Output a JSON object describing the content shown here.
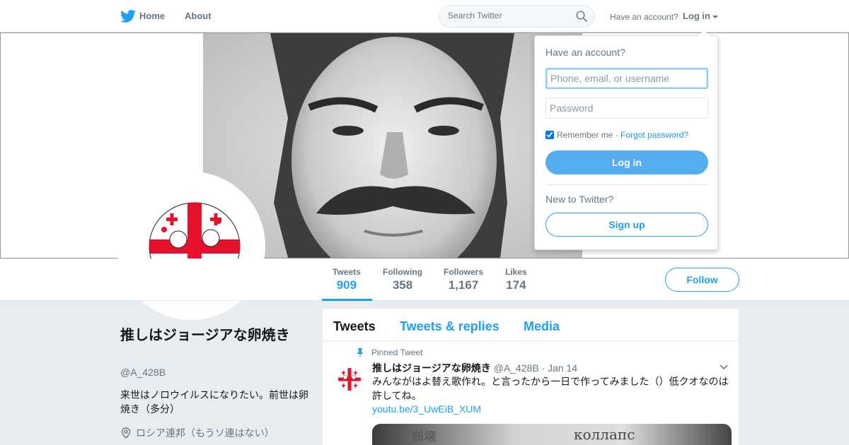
{
  "topbar": {
    "home_label": "Home",
    "about_label": "About",
    "search_placeholder": "Search Twitter",
    "have_account": "Have an account?",
    "login_label": "Log in"
  },
  "profile": {
    "name": "推しはジョージアな卵焼き",
    "handle": "@A_428B",
    "bio": "来世はノロウイルスになりたい。前世は卵焼き（多分）",
    "location": "ロシア連邦（もうソ連はない）"
  },
  "stats": [
    {
      "label": "Tweets",
      "value": "909"
    },
    {
      "label": "Following",
      "value": "358"
    },
    {
      "label": "Followers",
      "value": "1,167"
    },
    {
      "label": "Likes",
      "value": "174"
    }
  ],
  "follow_label": "Follow",
  "timeline": {
    "tabs": [
      "Tweets",
      "Tweets & replies",
      "Media"
    ],
    "pinned_label": "Pinned Tweet",
    "tweet": {
      "name": "推しはジョージアな卵焼き",
      "meta": "@A_428B · Jan 14",
      "text": "みんながはよ替え歌作れ。と言ったから一日で作ってみました（）低クオなのは許してね。",
      "link": "youtu.be/3_UwEiB_XUM",
      "media_text_left": "崩壊",
      "media_text_right": "коллапс"
    }
  },
  "login_dropdown": {
    "title": "Have an account?",
    "username_placeholder": "Phone, email, or username",
    "password_placeholder": "Password",
    "remember_label": "Remember me",
    "separator": " · ",
    "forgot_label": "Forgot password?",
    "login_button": "Log in",
    "new_label": "New to Twitter?",
    "signup_button": "Sign up"
  },
  "colors": {
    "accent": "#1da1f2",
    "login_button": "#55acee",
    "flag_red": "#e8112d"
  }
}
